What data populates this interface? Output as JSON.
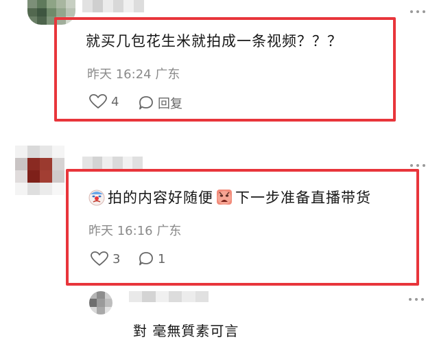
{
  "comments": [
    {
      "text": "就买几包花生米就拍成一条视频？？？",
      "meta": "昨天 16:24 广东",
      "likes": "4",
      "reply_label": "回复"
    },
    {
      "text_part1": "拍的内容好随便",
      "text_part2": "下一步准备直播带货",
      "meta": "昨天 16:16 广东",
      "likes": "3",
      "replies": "1"
    }
  ],
  "reply": {
    "text": "對 毫無質素可言"
  },
  "icons": {
    "like": "heart-outline-icon",
    "reply": "speech-bubble-icon",
    "more": "more-dots-icon"
  },
  "colors": {
    "highlight": "#e8353b",
    "meta": "#8a8a8a"
  }
}
